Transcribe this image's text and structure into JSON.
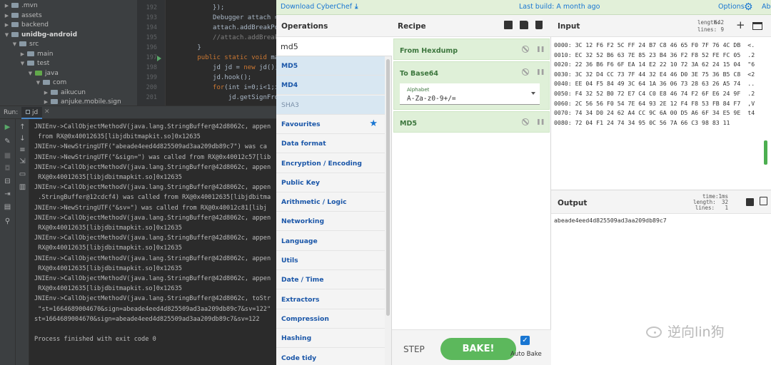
{
  "ide": {
    "tree": [
      {
        "label": ".mvn",
        "expanded": false,
        "indent": 1,
        "bold": false,
        "folder": "gray"
      },
      {
        "label": "assets",
        "expanded": false,
        "indent": 1,
        "bold": false,
        "folder": "gray"
      },
      {
        "label": "backend",
        "expanded": false,
        "indent": 1,
        "bold": false,
        "folder": "gray"
      },
      {
        "label": "unidbg-android",
        "expanded": true,
        "indent": 1,
        "bold": true,
        "folder": "gray"
      },
      {
        "label": "src",
        "expanded": true,
        "indent": 2,
        "bold": false,
        "folder": "gray"
      },
      {
        "label": "main",
        "expanded": false,
        "indent": 3,
        "bold": false,
        "folder": "gray"
      },
      {
        "label": "test",
        "expanded": true,
        "indent": 3,
        "bold": false,
        "folder": "gray"
      },
      {
        "label": "java",
        "expanded": true,
        "indent": 4,
        "bold": false,
        "folder": "green"
      },
      {
        "label": "com",
        "expanded": true,
        "indent": 5,
        "bold": false,
        "folder": "gray"
      },
      {
        "label": "aikucun",
        "expanded": false,
        "indent": 6,
        "bold": false,
        "folder": "gray"
      },
      {
        "label": "anjuke.mobile.sign",
        "expanded": false,
        "indent": 6,
        "bold": false,
        "folder": "gray"
      }
    ],
    "line_numbers": [
      "192",
      "193",
      "194",
      "195",
      "196",
      "197",
      "198",
      "199",
      "200",
      "201"
    ],
    "code_lines": [
      {
        "text": "            });"
      },
      {
        "text": "            Debugger attach = "
      },
      {
        "text": "            attach.addBreakPoi"
      },
      {
        "text": "            //attach.addBreakPo",
        "comment": true
      },
      {
        "text": "        }"
      },
      {
        "text": "        public static void mai",
        "keyword": "public static void"
      },
      {
        "text": "            jd jd = new jd();",
        "keyword": "new"
      },
      {
        "text": "            jd.hook();"
      },
      {
        "text": "            for(int i=0;i<1;i+",
        "keyword": "for"
      },
      {
        "text": "                jd.getSignFrom"
      }
    ],
    "run_label": "Run:",
    "run_tab": "jd",
    "console_lines": [
      "JNIEnv->CallObjectMethodV(java.lang.StringBuffer@42d8062c, appen",
      " from RX@0x40012635[libjdbitmapkit.so]0x12635",
      "JNIEnv->NewStringUTF(\"abeade4eed4d825509ad3aa209db89c7\") was ca",
      "JNIEnv->NewStringUTF(\"&sign=\") was called from RX@0x40012c57[lib",
      "JNIEnv->CallObjectMethodV(java.lang.StringBuffer@42d8062c, appen",
      " RX@0x40012635[libjdbitmapkit.so]0x12635",
      "JNIEnv->CallObjectMethodV(java.lang.StringBuffer@42d8062c, appen",
      " .StringBuffer@12cdcf4) was called from RX@0x40012635[libjdbitma",
      "JNIEnv->NewStringUTF(\"&sv=\") was called from RX@0x40012c81[libj",
      "JNIEnv->CallObjectMethodV(java.lang.StringBuffer@42d8062c, appen",
      " RX@0x40012635[libjdbitmapkit.so]0x12635",
      "JNIEnv->CallObjectMethodV(java.lang.StringBuffer@42d8062c, appen",
      " RX@0x40012635[libjdbitmapkit.so]0x12635",
      "JNIEnv->CallObjectMethodV(java.lang.StringBuffer@42d8062c, appen",
      " RX@0x40012635[libjdbitmapkit.so]0x12635",
      "JNIEnv->CallObjectMethodV(java.lang.StringBuffer@42d8062c, appen",
      " RX@0x40012635[libjdbitmapkit.so]0x12635",
      "JNIEnv->CallObjectMethodV(java.lang.StringBuffer@42d8062c, toStr",
      " \"st=1664689004670&sign=abeade4eed4d825509ad3aa209db89c7&sv=122\"",
      "st=1664689004670&sign=abeade4eed4d825509ad3aa209db89c7&sv=122",
      "",
      "Process finished with exit code 0"
    ]
  },
  "chef": {
    "top": {
      "download": "Download CyberChef",
      "last_build": "Last build: A month ago",
      "options": "Options",
      "about": "Abo"
    },
    "operations": {
      "title": "Operations",
      "search_value": "md5",
      "items": [
        {
          "label": "MD5",
          "style": "hl"
        },
        {
          "label": "MD4",
          "style": "hl"
        },
        {
          "label": "SHA3",
          "style": "hl-light"
        },
        {
          "label": "Favourites",
          "style": "fav"
        },
        {
          "label": "Data format",
          "style": ""
        },
        {
          "label": "Encryption / Encoding",
          "style": ""
        },
        {
          "label": "Public Key",
          "style": ""
        },
        {
          "label": "Arithmetic / Logic",
          "style": ""
        },
        {
          "label": "Networking",
          "style": ""
        },
        {
          "label": "Language",
          "style": ""
        },
        {
          "label": "Utils",
          "style": ""
        },
        {
          "label": "Date / Time",
          "style": ""
        },
        {
          "label": "Extractors",
          "style": ""
        },
        {
          "label": "Compression",
          "style": ""
        },
        {
          "label": "Hashing",
          "style": ""
        },
        {
          "label": "Code tidy",
          "style": ""
        }
      ]
    },
    "recipe": {
      "title": "Recipe",
      "ops": [
        {
          "name": "From Hexdump"
        },
        {
          "name": "To Base64",
          "arg_label": "Alphabet",
          "arg_value": "A-Za-z0-9+/="
        },
        {
          "name": "MD5"
        }
      ],
      "step": "STEP",
      "bake": "BAKE!",
      "auto_bake": "Auto Bake",
      "auto_bake_checked": true
    },
    "input": {
      "title": "Input",
      "length_label": "length:",
      "length": "642",
      "lines_label": "lines:",
      "lines": "9",
      "hex_lines": [
        {
          "text": "0000: 3C 12 F6 F2 5C FF 24 B7 C8 46 65 F0 7F 76 4C DB",
          "tail": "<."
        },
        {
          "text": "0010: EC 32 52 B6 63 7E 85 23 B4 36 F2 F8 52 FE FC 05",
          "tail": ".2"
        },
        {
          "text": "0020: 22 36 B6 F6 6F EA 14 E2 22 10 72 3A 62 24 15 04",
          "tail": "\"6"
        },
        {
          "text": "0030: 3C 32 D4 CC 73 7F 44 32 E4 46 D0 3E 75 36 B5 C8",
          "tail": "<2"
        },
        {
          "text": "0040: EE 04 F5 84 49 3C 64 1A 36 06 73 28 63 26 A5 74",
          "tail": ".."
        },
        {
          "text": "0050: F4 32 52 B0 72 E7 C4 C0 E8 46 74 F2 6F E6 24 9F",
          "tail": ".2"
        },
        {
          "text": "0060: 2C 56 56 F0 54 7E 64 93 2E 12 F4 F8 53 FB 84 F7",
          "tail": ",V"
        },
        {
          "text": "0070: 74 34 D0 24 62 A4 CC 9C 6A 00 D5 A6 6F 34 E5 9E",
          "tail": "t4"
        },
        {
          "text": "0080: 72 04 F1 24 74 34 95 0C 56 7A 66 C3 98 83 11",
          "tail": ""
        }
      ]
    },
    "output": {
      "title": "Output",
      "time_label": "time:",
      "time": "1ms",
      "length_label": "length:",
      "length": "32",
      "lines_label": "lines:",
      "lines": "1",
      "value": "abeade4eed4d825509ad3aa209db89c7"
    },
    "watermark": "逆向lin狗"
  }
}
